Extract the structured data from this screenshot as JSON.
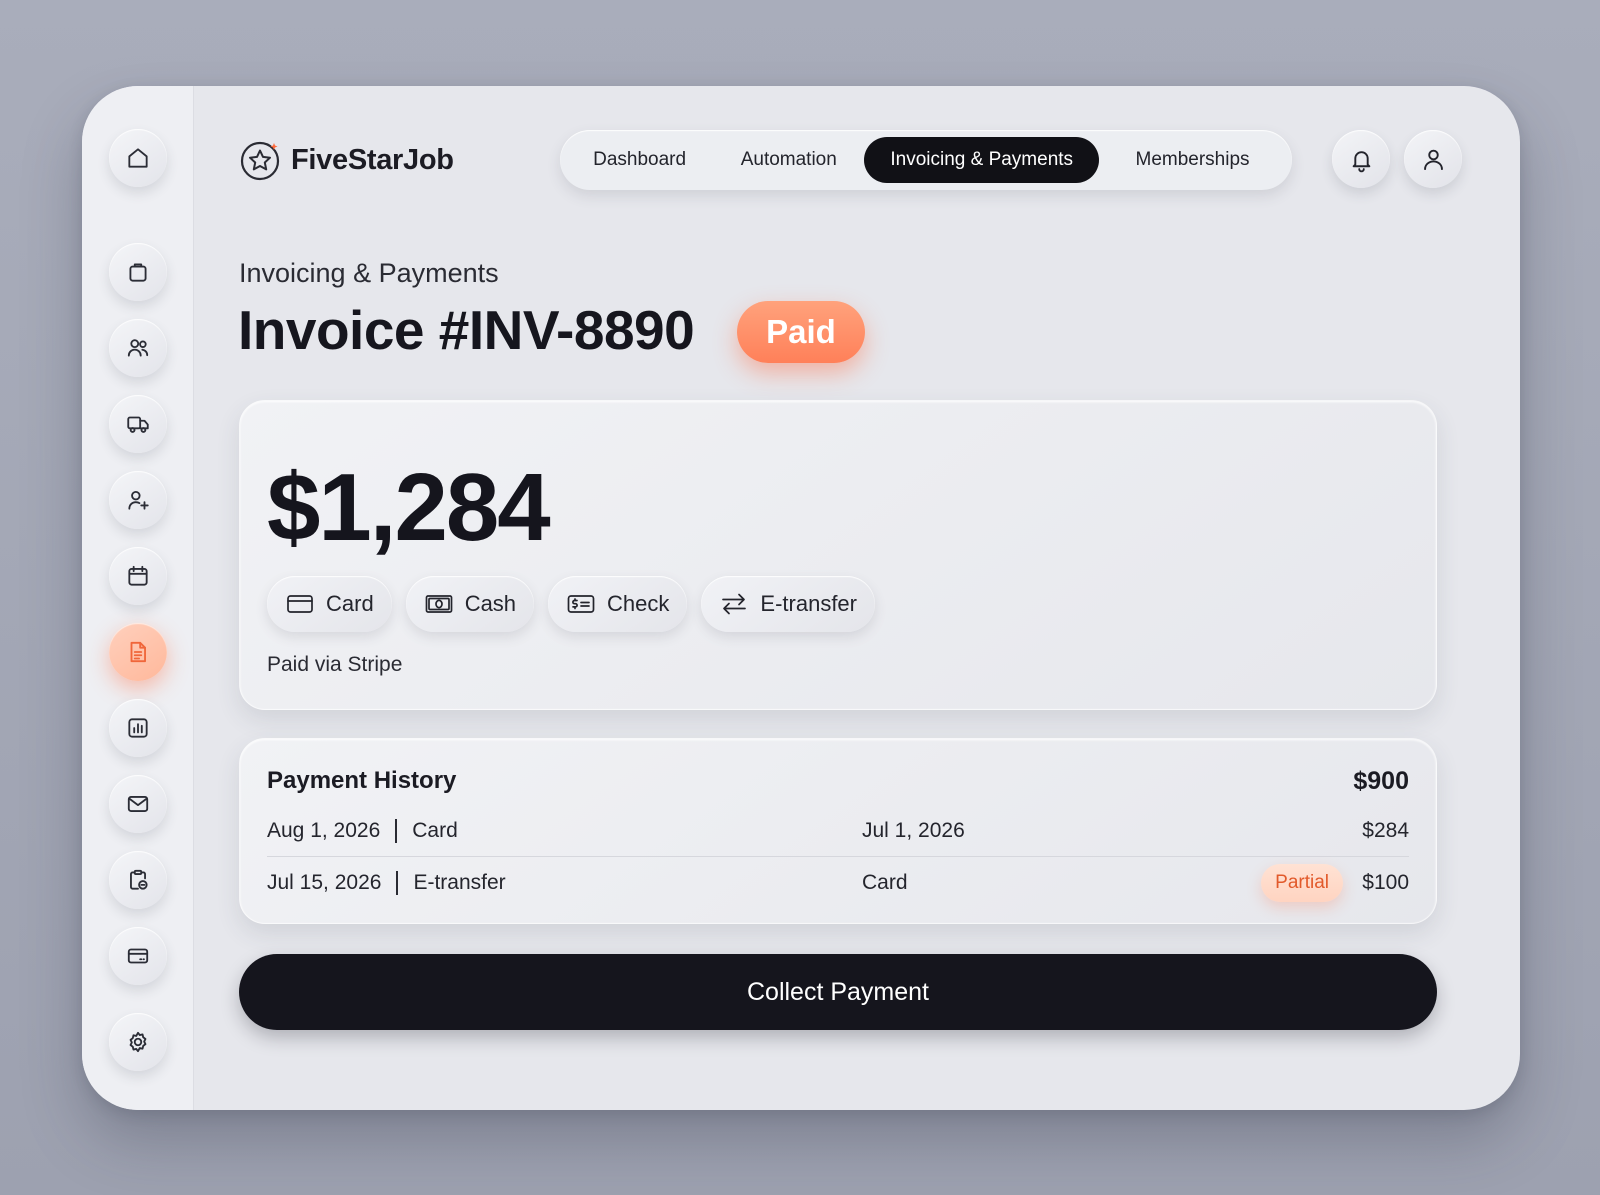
{
  "brand": {
    "name": "FiveStarJob",
    "accent": "#ff8059"
  },
  "nav": {
    "tabs": [
      {
        "label": "Dashboard",
        "active": false
      },
      {
        "label": "Automation",
        "active": false
      },
      {
        "label": "Invoicing & Payments",
        "active": true
      },
      {
        "label": "Memberships",
        "active": false
      }
    ]
  },
  "header_icons": [
    "bell-icon",
    "user-icon"
  ],
  "sidebar": {
    "items": [
      {
        "icon": "home-icon"
      },
      {
        "icon": "briefcase-icon"
      },
      {
        "icon": "users-icon"
      },
      {
        "icon": "truck-icon"
      },
      {
        "icon": "user-plus-icon"
      },
      {
        "icon": "calendar-icon"
      },
      {
        "icon": "document-icon",
        "active": true
      },
      {
        "icon": "bar-chart-icon"
      },
      {
        "icon": "mail-icon"
      },
      {
        "icon": "clipboard-icon"
      },
      {
        "icon": "credit-card-icon"
      },
      {
        "icon": "settings-icon"
      }
    ]
  },
  "page": {
    "subtitle": "Invoicing & Payments",
    "title": "Invoice #INV-8890",
    "status": "Paid"
  },
  "summary": {
    "amount": "$1,284",
    "methods": [
      {
        "label": "Card",
        "icon": "card-icon"
      },
      {
        "label": "Cash",
        "icon": "cash-icon"
      },
      {
        "label": "Check",
        "icon": "check-icon"
      },
      {
        "label": "E-transfer",
        "icon": "transfer-icon"
      }
    ],
    "paid_via": "Paid via Stripe"
  },
  "history": {
    "title": "Payment History",
    "total": "$900",
    "rows": [
      {
        "date": "Aug 1, 2026",
        "method": "Card",
        "mid": "Jul 1, 2026",
        "badge": "",
        "amount": "$284"
      },
      {
        "date": "Jul 15, 2026",
        "method": "E-transfer",
        "mid": "Card",
        "badge": "Partial",
        "amount": "$100"
      }
    ]
  },
  "actions": {
    "collect": "Collect Payment"
  }
}
